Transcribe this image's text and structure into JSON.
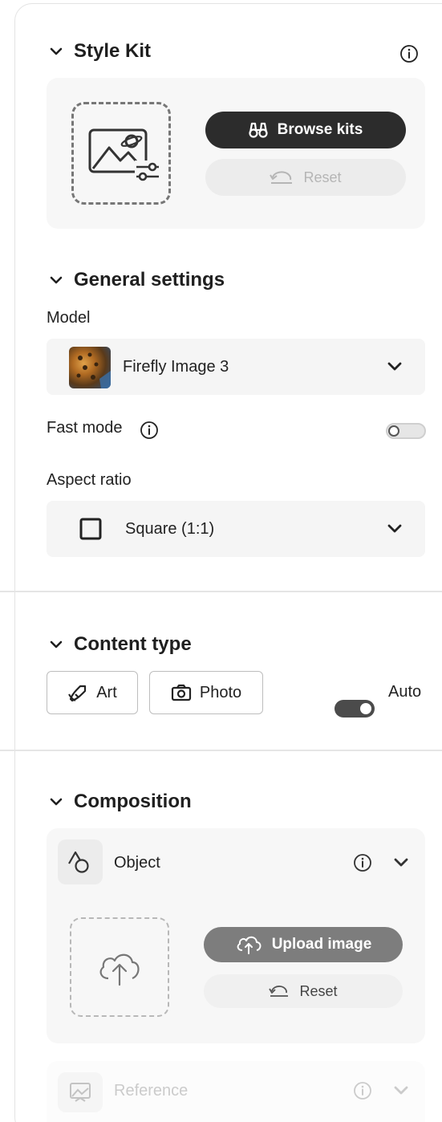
{
  "style_kit": {
    "title": "Style Kit",
    "browse_label": "Browse kits",
    "reset_label": "Reset"
  },
  "general": {
    "title": "General settings",
    "model_label": "Model",
    "model_value": "Firefly Image 3",
    "fast_mode_label": "Fast mode",
    "fast_mode_on": false,
    "aspect_label": "Aspect ratio",
    "aspect_value": "Square (1:1)"
  },
  "content_type": {
    "title": "Content type",
    "art_label": "Art",
    "photo_label": "Photo",
    "auto_label": "Auto",
    "auto_on": true
  },
  "composition": {
    "title": "Composition",
    "object_label": "Object",
    "upload_label": "Upload image",
    "reset_label": "Reset",
    "reference_label": "Reference"
  },
  "icons": {
    "section_toggle": "chevron-down-icon",
    "info": "info-icon",
    "binoculars": "binoculars-icon",
    "undo": "undo-icon",
    "upload": "cloud-upload-icon",
    "art": "brush-icon",
    "photo": "camera-icon",
    "shapes": "shapes-icon",
    "square": "square-icon"
  },
  "colors": {
    "primary_button": "#2c2c2c",
    "upload_button": "#7d7d7d",
    "card_bg": "#f7f7f7",
    "toggle_on": "#4b4b4b"
  }
}
